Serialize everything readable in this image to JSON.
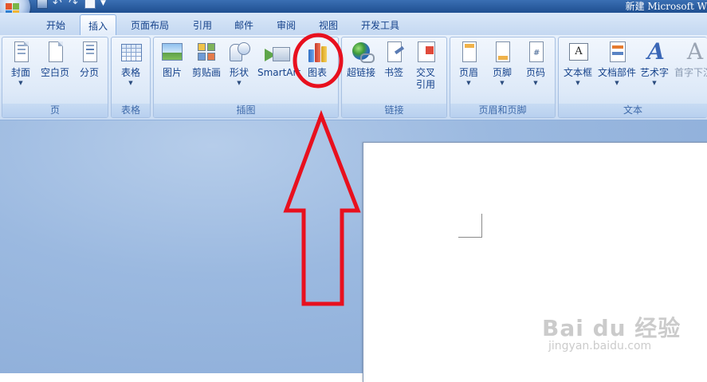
{
  "window": {
    "title": "新建 Microsoft W"
  },
  "quick_access": {
    "icons": [
      "save-icon",
      "undo-icon",
      "redo-icon",
      "print-preview-icon",
      "customize-dropdown-icon"
    ]
  },
  "tabs": [
    {
      "label": "开始",
      "active": false
    },
    {
      "label": "插入",
      "active": true
    },
    {
      "label": "页面布局",
      "active": false
    },
    {
      "label": "引用",
      "active": false
    },
    {
      "label": "邮件",
      "active": false
    },
    {
      "label": "审阅",
      "active": false
    },
    {
      "label": "视图",
      "active": false
    },
    {
      "label": "开发工具",
      "active": false
    }
  ],
  "ribbon": {
    "groups": {
      "pages": {
        "label": "页",
        "buttons": [
          {
            "label": "封面",
            "icon": "cover-page-icon",
            "dropdown": true
          },
          {
            "label": "空白页",
            "icon": "blank-page-icon",
            "dropdown": false
          },
          {
            "label": "分页",
            "icon": "page-break-icon",
            "dropdown": false
          }
        ]
      },
      "tables": {
        "label": "表格",
        "buttons": [
          {
            "label": "表格",
            "icon": "table-icon",
            "dropdown": true
          }
        ]
      },
      "illustrations": {
        "label": "插图",
        "buttons": [
          {
            "label": "图片",
            "icon": "picture-icon",
            "dropdown": false
          },
          {
            "label": "剪贴画",
            "icon": "clip-art-icon",
            "dropdown": false
          },
          {
            "label": "形状",
            "icon": "shapes-icon",
            "dropdown": true
          },
          {
            "label": "SmartArt",
            "icon": "smartart-icon",
            "dropdown": false
          },
          {
            "label": "图表",
            "icon": "chart-icon",
            "dropdown": false
          }
        ]
      },
      "links": {
        "label": "链接",
        "buttons": [
          {
            "label": "超链接",
            "icon": "hyperlink-icon",
            "dropdown": false
          },
          {
            "label": "书签",
            "icon": "bookmark-icon",
            "dropdown": false
          },
          {
            "label": "交叉",
            "label2": "引用",
            "icon": "cross-reference-icon",
            "dropdown": false
          }
        ]
      },
      "header_footer": {
        "label": "页眉和页脚",
        "buttons": [
          {
            "label": "页眉",
            "icon": "header-icon",
            "dropdown": true
          },
          {
            "label": "页脚",
            "icon": "footer-icon",
            "dropdown": true
          },
          {
            "label": "页码",
            "icon": "page-number-icon",
            "dropdown": true
          }
        ]
      },
      "text": {
        "label": "文本",
        "buttons": [
          {
            "label": "文本框",
            "icon": "text-box-icon",
            "dropdown": true
          },
          {
            "label": "文档部件",
            "icon": "quick-parts-icon",
            "dropdown": true
          },
          {
            "label": "艺术字",
            "icon": "wordart-icon",
            "dropdown": true
          },
          {
            "label": "首字下沉",
            "icon": "drop-cap-icon",
            "dropdown": true
          }
        ]
      }
    }
  },
  "annotation": {
    "highlight_color": "#e8101e",
    "target": "图表"
  },
  "watermark": {
    "brand": "Bai du 经验",
    "url": "jingyan.baidu.com"
  }
}
